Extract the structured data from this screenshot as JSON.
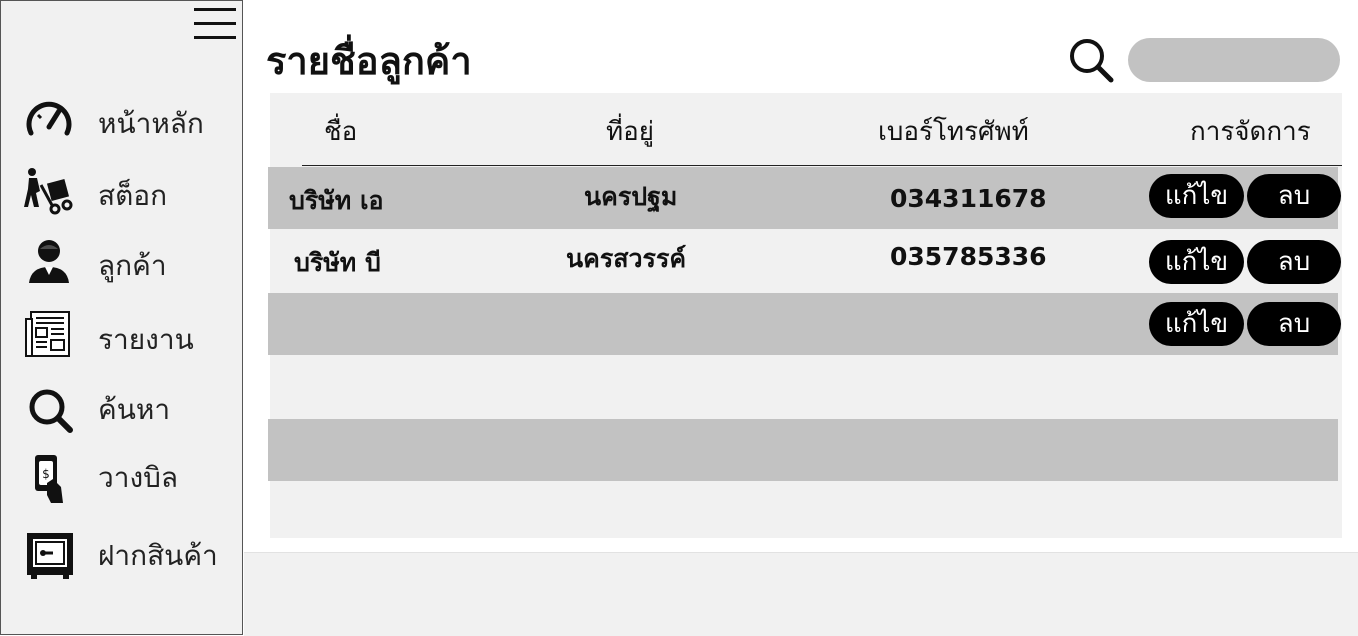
{
  "sidebar": {
    "items": [
      {
        "label": "หน้าหลัก",
        "icon": "speedometer-icon"
      },
      {
        "label": "สต็อก",
        "icon": "hand-truck-icon"
      },
      {
        "label": "ลูกค้า",
        "icon": "customer-icon"
      },
      {
        "label": "รายงาน",
        "icon": "newspaper-icon"
      },
      {
        "label": "ค้นหา",
        "icon": "search-icon"
      },
      {
        "label": "วางบิล",
        "icon": "bill-payment-icon"
      },
      {
        "label": "ฝากสินค้า",
        "icon": "safe-icon"
      }
    ]
  },
  "header": {
    "title": "รายชื่อลูกค้า",
    "search_placeholder": ""
  },
  "table": {
    "columns": [
      "ชื่อ",
      "ที่อยู่",
      "เบอร์โทรศัพท์",
      "การจัดการ"
    ],
    "rows": [
      {
        "name": "บริษัท เอ",
        "address": "นครปฐม",
        "phone": "034311678"
      },
      {
        "name": "บริษัท บี",
        "address": "นครสวรรค์",
        "phone": "035785336"
      },
      {
        "name": "",
        "address": "",
        "phone": ""
      }
    ],
    "edit_label": "แก้ไข",
    "delete_label": "ลบ"
  },
  "colors": {
    "sidebar_bg": "#f1f1f1",
    "row_gray": "#c2c2c2",
    "button_bg": "#000000",
    "button_text": "#ffffff"
  }
}
